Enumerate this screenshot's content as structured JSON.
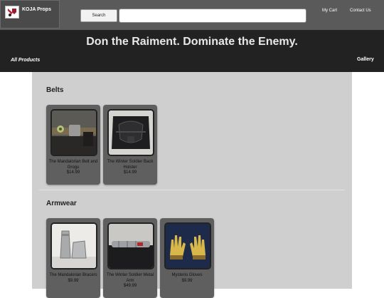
{
  "header": {
    "brand": "KOJA Props",
    "search_button": "Search",
    "search_placeholder": "",
    "nav": {
      "cart": "My Cart",
      "contact": "Contact Us"
    }
  },
  "hero": {
    "title": "Don the Raiment. Dominate the Enemy.",
    "left_link": "All Products",
    "right_link": "Gallery"
  },
  "sections": [
    {
      "title": "Belts",
      "products": [
        {
          "name": "The Mandalorian Belt and Grogu",
          "price": "$14.99"
        },
        {
          "name": "The Winter Soldier Back Holster",
          "price": "$14.99"
        }
      ]
    },
    {
      "title": "Armwear",
      "products": [
        {
          "name": "The Mandalorian Bracers",
          "price": "$9.99"
        },
        {
          "name": "The Winter Soldier Metal Arm",
          "price": "$49.99"
        },
        {
          "name": "Mysterio Gloves",
          "price": "$9.99"
        }
      ]
    }
  ]
}
